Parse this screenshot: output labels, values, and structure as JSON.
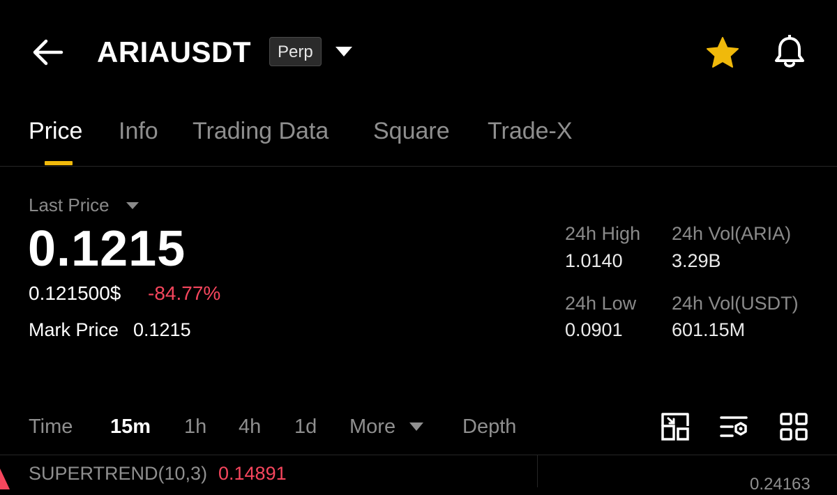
{
  "header": {
    "symbol": "ARIAUSDT",
    "contract_type": "Perp"
  },
  "tabs": [
    {
      "label": "Price",
      "active": true
    },
    {
      "label": "Info"
    },
    {
      "label": "Trading Data"
    },
    {
      "label": "Square"
    },
    {
      "label": "Trade-X"
    }
  ],
  "price": {
    "label": "Last Price",
    "last": "0.1215",
    "usd": "0.121500$",
    "change": "-84.77%",
    "mark_label": "Mark Price",
    "mark_value": "0.1215"
  },
  "stats": {
    "high_label": "24h High",
    "high": "1.0140",
    "low_label": "24h Low",
    "low": "0.0901",
    "vol_base_label": "24h Vol(ARIA)",
    "vol_base": "3.29B",
    "vol_quote_label": "24h Vol(USDT)",
    "vol_quote": "601.15M"
  },
  "timeframes": {
    "time": "Time",
    "items": [
      "15m",
      "1h",
      "4h",
      "1d"
    ],
    "active": "15m",
    "more": "More",
    "depth": "Depth"
  },
  "chart": {
    "indicator": "SUPERTREND(10,3)",
    "indicator_value": "0.14891",
    "axis_price": "0.24163"
  },
  "colors": {
    "accent": "#f0b90b",
    "negative": "#f6465d",
    "background": "#000000",
    "muted_text": "#8f8f8f"
  },
  "icons": {
    "back": "back-arrow-icon",
    "dropdown": "chevron-down-icon",
    "favorite": "star-icon",
    "alert": "bell-icon",
    "tool1": "chart-fullscreen-icon",
    "tool2": "indicator-settings-icon",
    "tool3": "grid-layout-icon"
  }
}
